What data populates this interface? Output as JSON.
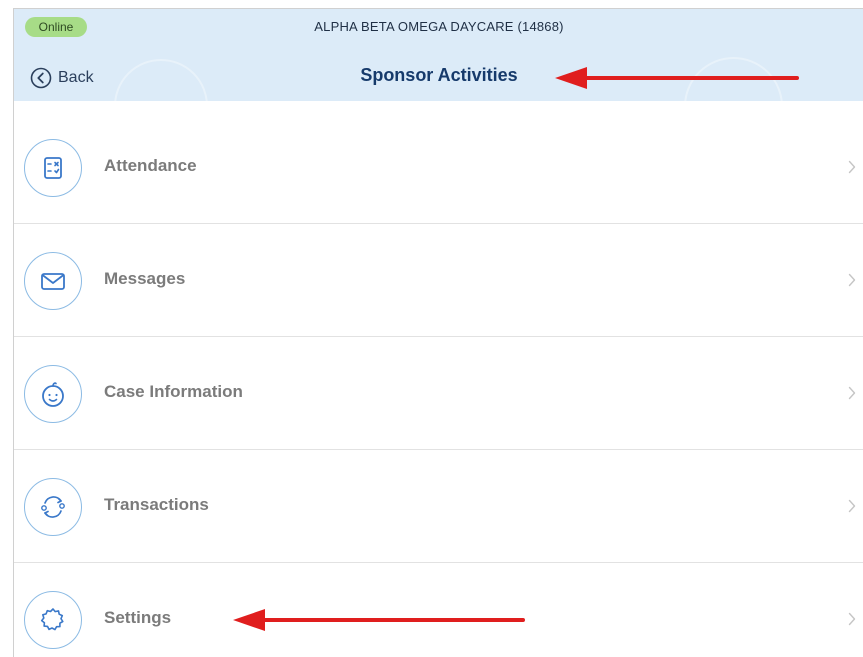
{
  "status": {
    "label": "Online",
    "color": "#a7dc87"
  },
  "header": {
    "org_title": "ALPHA BETA OMEGA DAYCARE (14868)",
    "back_label": "Back",
    "back_icon": "chevron-left-circle-icon",
    "page_title": "Sponsor Activities",
    "background": "#dcebf8"
  },
  "menu": {
    "items": [
      {
        "label": "Attendance",
        "icon": "attendance-checklist-icon"
      },
      {
        "label": "Messages",
        "icon": "envelope-icon"
      },
      {
        "label": "Case Information",
        "icon": "baby-face-icon"
      },
      {
        "label": "Transactions",
        "icon": "exchange-people-icon"
      },
      {
        "label": "Settings",
        "icon": "gear-icon"
      }
    ],
    "chevron_icon": "chevron-right-icon"
  },
  "annotations": {
    "arrow_color": "#e01e1e",
    "arrows": [
      {
        "target": "page-title"
      },
      {
        "target": "menu-item-settings"
      }
    ]
  },
  "colors": {
    "icon_stroke": "#3a78c9",
    "icon_ring": "#8cbbe4",
    "label_text": "#7b7b7b",
    "title_text": "#163a6b"
  }
}
